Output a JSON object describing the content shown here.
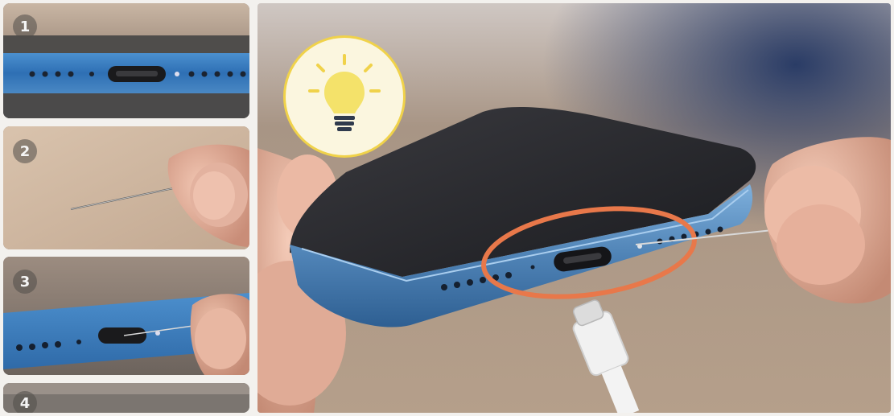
{
  "steps": [
    {
      "number": "1"
    },
    {
      "number": "2"
    },
    {
      "number": "3"
    },
    {
      "number": "4"
    }
  ],
  "main_photo": {
    "icon": "lightbulb-icon",
    "highlight_color": "#e8784a",
    "phone_frame_color": "#5a8bb8"
  }
}
